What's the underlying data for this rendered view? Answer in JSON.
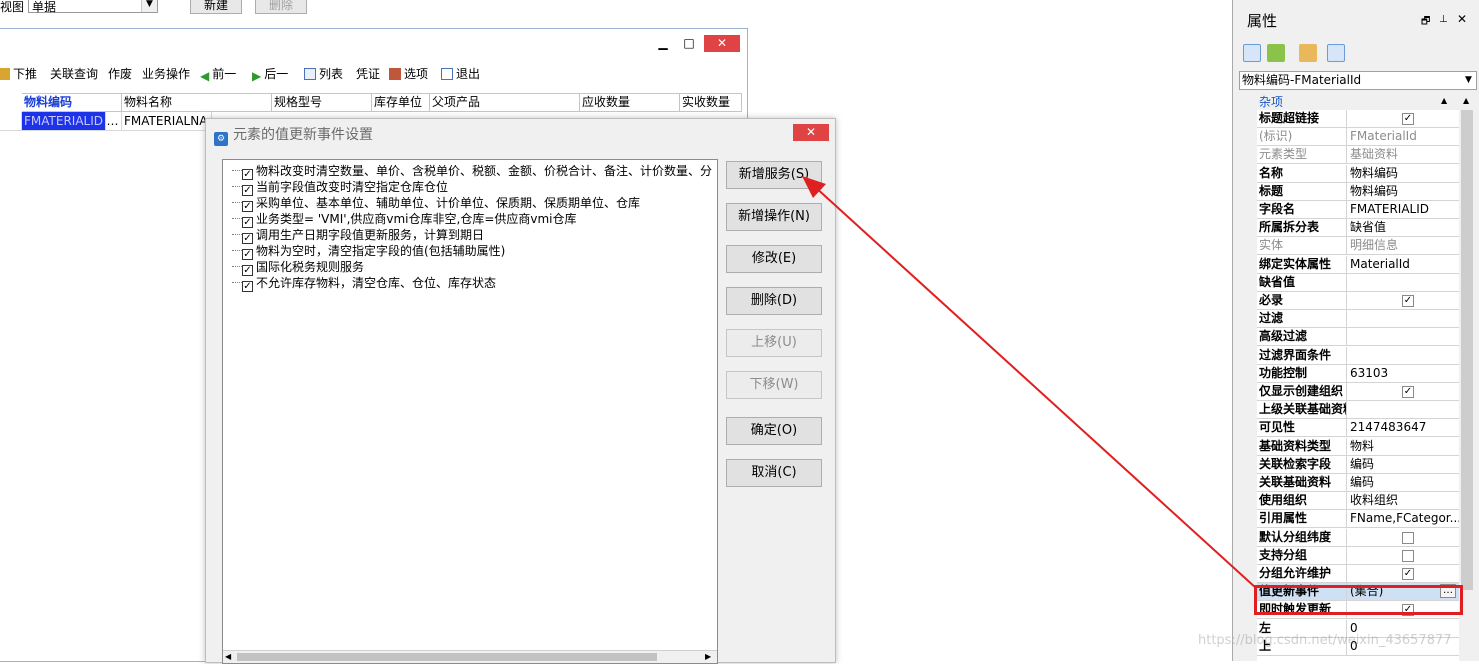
{
  "top": {
    "view_label": "视图",
    "view_value": "单据",
    "new_label": "新建",
    "delete_label": "删除"
  },
  "toolbar": {
    "push_down": "下推",
    "linked_query": "关联查询",
    "void": "作废",
    "business_ops": "业务操作",
    "prev": "前一",
    "next": "后一",
    "list": "列表",
    "voucher": "凭证",
    "options": "选项",
    "exit": "退出"
  },
  "grid": {
    "headers": [
      "物料编码",
      "物料名称",
      "规格型号",
      "库存单位",
      "父项产品",
      "应收数量",
      "实收数量"
    ],
    "row": [
      "FMATERIALID",
      "FMATERIALNA"
    ]
  },
  "dialog": {
    "title": "元素的值更新事件设置",
    "items": [
      "物料改变时清空数量、单价、含税单价、税额、金额、价税合计、备注、计价数量、分",
      "当前字段值改变时清空指定仓库仓位",
      "采购单位、基本单位、辅助单位、计价单位、保质期、保质期单位、仓库",
      "业务类型= 'VMI',供应商vmi仓库非空,仓库=供应商vmi仓库",
      "调用生产日期字段值更新服务，计算到期日",
      "物料为空时，清空指定字段的值(包括辅助属性)",
      "国际化税务规则服务",
      "不允许库存物料，清空仓库、仓位、库存状态"
    ],
    "buttons": {
      "add_service": "新增服务(S)",
      "add_operation": "新增操作(N)",
      "modify": "修改(E)",
      "delete": "删除(D)",
      "move_up": "上移(U)",
      "move_down": "下移(W)",
      "ok": "确定(O)",
      "cancel": "取消(C)"
    }
  },
  "panel": {
    "title": "属性",
    "selector": "物料编码-FMaterialId",
    "category": "杂项",
    "rows": [
      {
        "name": "标题超链接",
        "check": true
      },
      {
        "name": "(标识)",
        "value": "FMaterialId",
        "readonly": true
      },
      {
        "name": "元素类型",
        "value": "基础资料",
        "readonly": true
      },
      {
        "name": "名称",
        "value": "物料编码"
      },
      {
        "name": "标题",
        "value": "物料编码"
      },
      {
        "name": "字段名",
        "value": "FMATERIALID"
      },
      {
        "name": "所属拆分表",
        "value": "缺省值"
      },
      {
        "name": "实体",
        "value": "明细信息",
        "readonly": true
      },
      {
        "name": "绑定实体属性",
        "value": "MaterialId"
      },
      {
        "name": "缺省值",
        "value": ""
      },
      {
        "name": "必录",
        "check": true
      },
      {
        "name": "过滤",
        "value": ""
      },
      {
        "name": "高级过滤",
        "value": ""
      },
      {
        "name": "过滤界面条件",
        "value": ""
      },
      {
        "name": "功能控制",
        "value": "63103"
      },
      {
        "name": "仅显示创建组织",
        "check": true
      },
      {
        "name": "上级关联基础资料",
        "value": ""
      },
      {
        "name": "可见性",
        "value": "2147483647"
      },
      {
        "name": "基础资料类型",
        "value": "物料"
      },
      {
        "name": "关联检索字段",
        "value": "编码"
      },
      {
        "name": "关联基础资料",
        "value": "编码"
      },
      {
        "name": "使用组织",
        "value": "收料组织"
      },
      {
        "name": "引用属性",
        "value": "FName,FCategor..."
      },
      {
        "name": "默认分组纬度",
        "check": false
      },
      {
        "name": "支持分组",
        "check": false
      },
      {
        "name": "分组允许维护",
        "check": true
      },
      {
        "name": "值更新事件",
        "value": "(集合)",
        "highlight": true
      },
      {
        "name": "即时触发更新",
        "check": true
      },
      {
        "name": "左",
        "value": "0"
      },
      {
        "name": "上",
        "value": "0"
      }
    ]
  },
  "watermark": "https://blog.csdn.net/weixin_43657877",
  "colors": {
    "highlight_border": "#e02020",
    "arrow": "#e02020",
    "close": "#e04343"
  }
}
